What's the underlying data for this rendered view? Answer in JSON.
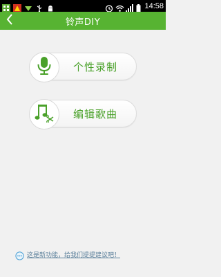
{
  "status_bar": {
    "time": "14:58",
    "icons": [
      "app-icon",
      "stop-icon",
      "download-icon",
      "usb-icon",
      "android-icon",
      "alarm-icon",
      "wifi-icon",
      "signal-icon",
      "battery-icon"
    ]
  },
  "header": {
    "title": "铃声DIY",
    "back_icon": "chevron-left-icon",
    "background": "#57b332"
  },
  "options": {
    "record": {
      "label": "个性录制",
      "icon": "microphone-icon"
    },
    "edit": {
      "label": "编辑歌曲",
      "icon": "music-scissors-icon"
    }
  },
  "feedback": {
    "text": "这是新功能，给我们提提建议吧！",
    "icon": "speech-bubble-icon"
  },
  "colors": {
    "accent": "#57b332",
    "label_green": "#4aa12a",
    "link": "#5a7f9a"
  }
}
